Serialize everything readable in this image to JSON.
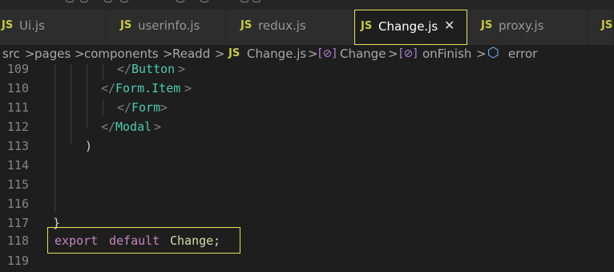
{
  "tabs": [
    {
      "icon": "JS",
      "label": "Ui.js",
      "active": false
    },
    {
      "icon": "JS",
      "label": "userinfo.js",
      "active": false
    },
    {
      "icon": "JS",
      "label": "redux.js",
      "active": false
    },
    {
      "icon": "JS",
      "label": "Change.js",
      "active": true,
      "close": "✕"
    },
    {
      "icon": "JS",
      "label": "proxy.js",
      "active": false
    },
    {
      "icon": "JS",
      "label": "",
      "active": false
    }
  ],
  "breadcrumb": {
    "items": [
      "src",
      "pages",
      "components",
      "Readd",
      "Change.js",
      "Change",
      "onFinish",
      "error"
    ],
    "file_icon": "JS",
    "separator": ">"
  },
  "code": {
    "lines": [
      {
        "number": "109",
        "tokens": [
          "</",
          "Button",
          ">"
        ]
      },
      {
        "number": "110",
        "tokens": [
          "</",
          "Form.Item",
          ">"
        ]
      },
      {
        "number": "111",
        "tokens": [
          "</",
          "Form",
          ">"
        ]
      },
      {
        "number": "112",
        "tokens": [
          "</",
          "Modal",
          ">"
        ]
      },
      {
        "number": "113",
        "tokens": [
          ")"
        ]
      },
      {
        "number": "114",
        "tokens": []
      },
      {
        "number": "115",
        "tokens": []
      },
      {
        "number": "116",
        "tokens": []
      },
      {
        "number": "117",
        "tokens": [
          "}"
        ]
      },
      {
        "number": "118",
        "tokens": [
          "export",
          "default",
          "Change",
          ";"
        ]
      },
      {
        "number": "119",
        "tokens": []
      }
    ]
  },
  "colors": {
    "highlight_border": "#e8e05a",
    "js_icon": "#cbcb41",
    "tag": "#4ec9b0",
    "keyword": "#c586c0",
    "identifier": "#dcdcaa"
  }
}
